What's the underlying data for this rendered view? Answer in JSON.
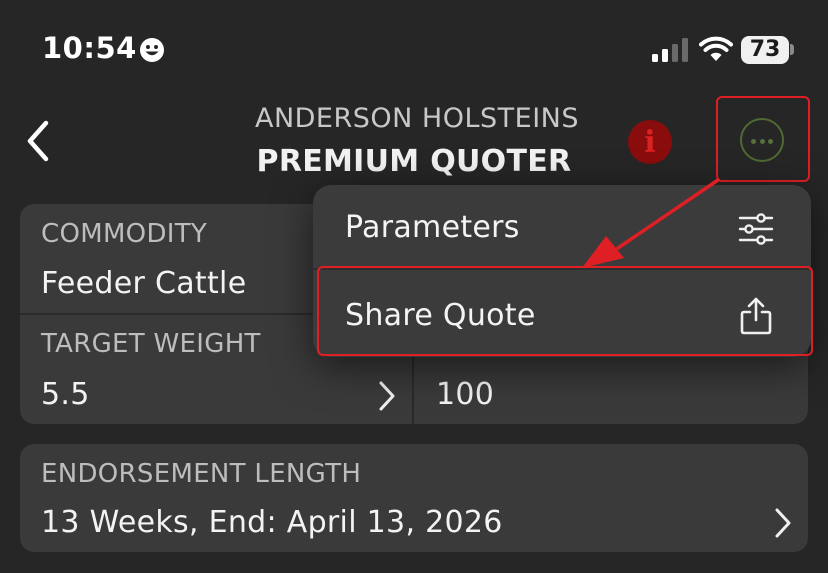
{
  "status_bar": {
    "time": "10:54",
    "smiley_icon": "smiley-face-icon",
    "signal_icon": "cellular-signal-icon",
    "wifi_icon": "wifi-icon",
    "battery_level": "73"
  },
  "nav": {
    "subtitle": "ANDERSON HOLSTEINS",
    "title": "PREMIUM QUOTER",
    "back_icon": "chevron-left-icon",
    "info_icon": "info-icon",
    "info_glyph": "i",
    "more_icon": "ellipsis-circle-icon"
  },
  "quote_form": {
    "commodity": {
      "label": "COMMODITY",
      "value": "Feeder Cattle"
    },
    "target_weight": {
      "label": "TARGET WEIGHT",
      "value": "5.5"
    },
    "second_value": "100",
    "endorsement": {
      "label": "ENDORSEMENT LENGTH",
      "value": "13 Weeks, End: April 13, 2026"
    }
  },
  "menu": {
    "items": [
      {
        "label": "Parameters",
        "icon": "sliders-icon"
      },
      {
        "label": "Share Quote",
        "icon": "share-icon"
      }
    ]
  },
  "annotation": {
    "highlight_color": "#e01f25",
    "arrow_color": "#e01f25"
  },
  "colors": {
    "background": "#262626",
    "card": "#3a3a3a",
    "menu": "#3b3b3b",
    "info_button": "#8a0d0d",
    "more_button": "#4f6a33"
  }
}
